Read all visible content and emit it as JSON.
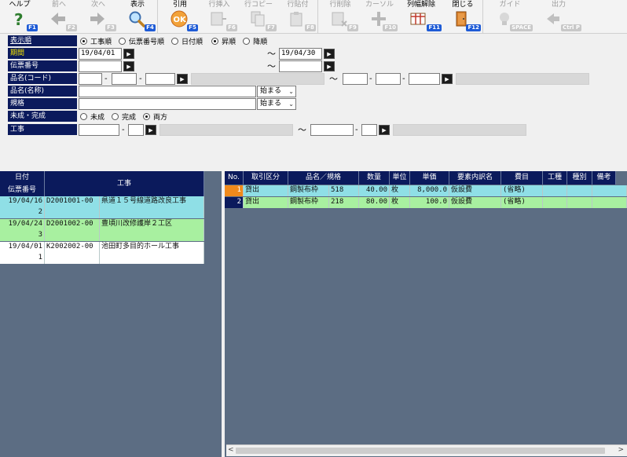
{
  "toolbar": [
    {
      "label": "ヘルプ",
      "key": "F1",
      "icon": "help-icon",
      "enabled": true
    },
    {
      "label": "前へ",
      "key": "F2",
      "icon": "arrow-left-icon",
      "enabled": false
    },
    {
      "label": "次へ",
      "key": "F3",
      "icon": "arrow-right-icon",
      "enabled": false
    },
    {
      "label": "表示",
      "key": "F4",
      "icon": "magnifier-icon",
      "enabled": true
    },
    {
      "label": "引用",
      "key": "F5",
      "icon": "ok-icon",
      "enabled": true
    },
    {
      "label": "行挿入",
      "key": "F6",
      "icon": "row-insert-icon",
      "enabled": false
    },
    {
      "label": "行コピー",
      "key": "F7",
      "icon": "row-copy-icon",
      "enabled": false
    },
    {
      "label": "行貼付",
      "key": "F8",
      "icon": "row-paste-icon",
      "enabled": false
    },
    {
      "label": "行削除",
      "key": "F9",
      "icon": "row-delete-icon",
      "enabled": false
    },
    {
      "label": "カーソル",
      "key": "F10",
      "icon": "cursor-icon",
      "enabled": false
    },
    {
      "label": "列幅解除",
      "key": "F11",
      "icon": "column-width-icon",
      "enabled": true
    },
    {
      "label": "閉じる",
      "key": "F12",
      "icon": "close-door-icon",
      "enabled": true
    },
    {
      "label": "ガイド",
      "key": "SPACE",
      "icon": "guide-bulb-icon",
      "enabled": false
    },
    {
      "label": "出力",
      "key": "Ctrl P",
      "icon": "output-icon",
      "enabled": false
    }
  ],
  "form": {
    "order_label": "表示順",
    "order_options": [
      "工事順",
      "伝票番号順",
      "日付順"
    ],
    "order_selected": 0,
    "sort_options": [
      "昇順",
      "降順"
    ],
    "sort_selected": 0,
    "period_label": "期間",
    "period_from": "19/04/01",
    "period_to": "19/04/30",
    "tilde": "～",
    "slip_label": "伝票番号",
    "code_label": "品名(コード)",
    "name_label": "品名(名称)",
    "name_mode": "始まる",
    "spec_label": "規格",
    "spec_mode": "始まる",
    "status_label": "未成・完成",
    "status_options": [
      "未成",
      "完成",
      "両方"
    ],
    "status_selected": 2,
    "work_label": "工事",
    "dash": "-"
  },
  "left_grid": {
    "header_date": "日付",
    "header_slip": "伝票番号",
    "header_work": "工事",
    "rows": [
      {
        "date": "19/04/16",
        "slip": "D2001001-00",
        "work": "県道１５号線道路改良工事",
        "line": "2",
        "color": "#8fdfe6"
      },
      {
        "date": "19/04/24",
        "slip": "D2001002-00",
        "work": "豊頃川改修護岸２工区",
        "line": "3",
        "color": "#a8f0a0"
      },
      {
        "date": "19/04/01",
        "slip": "K2002002-00",
        "work": "池田町多目的ホール工事",
        "line": "1",
        "color": "#ffffff"
      }
    ]
  },
  "right_grid": {
    "headers": [
      "No.",
      "取引区分",
      "品名／規格",
      "数量",
      "単位",
      "単価",
      "要素内訳名",
      "費目",
      "工種",
      "種別",
      "備考"
    ],
    "rows": [
      {
        "no": "1",
        "kubun": "貸出",
        "name": "鋼製布枠",
        "spec": "518",
        "qty": "40.00",
        "unit": "枚",
        "price": "8,000.0",
        "element": "仮設費",
        "himoku": "(省略)",
        "color": "#8fdfe6",
        "no_color": "#f08a1c"
      },
      {
        "no": "2",
        "kubun": "貸出",
        "name": "鋼製布枠",
        "spec": "218",
        "qty": "80.00",
        "unit": "枚",
        "price": "100.0",
        "element": "仮設費",
        "himoku": "(省略)",
        "color": "#a8f0a0",
        "no_color": "#0b1a5c"
      }
    ]
  },
  "colors": {
    "header_bg": "#0b1a5c",
    "grid_bg": "#5c6d83",
    "accent_key": "#1e5bd6"
  }
}
